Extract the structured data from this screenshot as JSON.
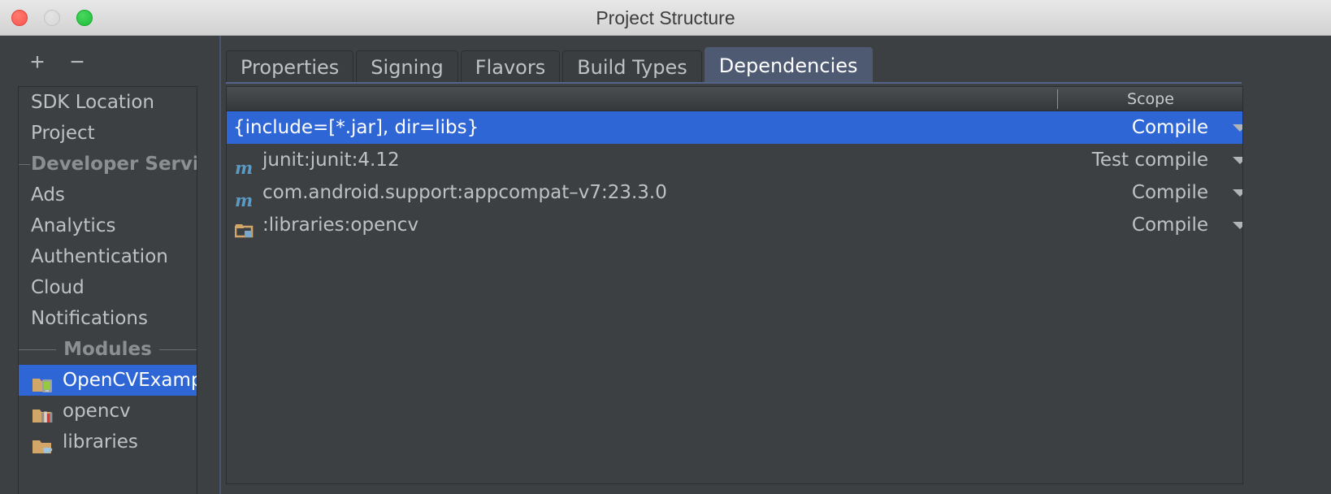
{
  "window": {
    "title": "Project Structure",
    "traffic_lights": [
      "close-red",
      "minimize-grey",
      "zoom-green"
    ]
  },
  "sidebar": {
    "toolbar": {
      "add_label": "+",
      "remove_label": "−"
    },
    "items": [
      {
        "label": "SDK Location",
        "type": "item",
        "icon": null,
        "selected": false
      },
      {
        "label": "Project",
        "type": "item",
        "icon": null,
        "selected": false
      },
      {
        "label": "Developer Services",
        "type": "group-left",
        "icon": null,
        "selected": false
      },
      {
        "label": "Ads",
        "type": "item",
        "icon": null,
        "selected": false
      },
      {
        "label": "Analytics",
        "type": "item",
        "icon": null,
        "selected": false
      },
      {
        "label": "Authentication",
        "type": "item",
        "icon": null,
        "selected": false
      },
      {
        "label": "Cloud",
        "type": "item",
        "icon": null,
        "selected": false
      },
      {
        "label": "Notifications",
        "type": "item",
        "icon": null,
        "selected": false
      },
      {
        "label": "Modules",
        "type": "group",
        "icon": null,
        "selected": false
      },
      {
        "label": "OpenCVExample",
        "type": "item",
        "icon": "android-module-icon",
        "selected": true
      },
      {
        "label": "opencv",
        "type": "item",
        "icon": "library-module-icon",
        "selected": false
      },
      {
        "label": "libraries",
        "type": "item",
        "icon": "java-module-icon",
        "selected": false
      }
    ]
  },
  "panel": {
    "tabs": [
      {
        "label": "Properties",
        "active": false
      },
      {
        "label": "Signing",
        "active": false
      },
      {
        "label": "Flavors",
        "active": false
      },
      {
        "label": "Build Types",
        "active": false
      },
      {
        "label": "Dependencies",
        "active": true
      }
    ],
    "table": {
      "columns": [
        "",
        "Scope"
      ],
      "rows": [
        {
          "name": "{include=[*.jar], dir=libs}",
          "scope": "Compile",
          "icon": null,
          "selected": true
        },
        {
          "name": "junit:junit:4.12",
          "scope": "Test compile",
          "icon": "maven-artifact-icon",
          "selected": false
        },
        {
          "name": "com.android.support:appcompat–v7:23.3.0",
          "scope": "Compile",
          "icon": "maven-artifact-icon",
          "selected": false
        },
        {
          "name": ":libraries:opencv",
          "scope": "Compile",
          "icon": "module-folder-icon",
          "selected": false
        }
      ]
    }
  },
  "colors": {
    "selection_blue": "#2f66d5",
    "panel_bg": "#3c4043",
    "active_tab_bg": "#4e5a72",
    "text": "#bfc2c4",
    "folder_tan": "#d2a568"
  }
}
